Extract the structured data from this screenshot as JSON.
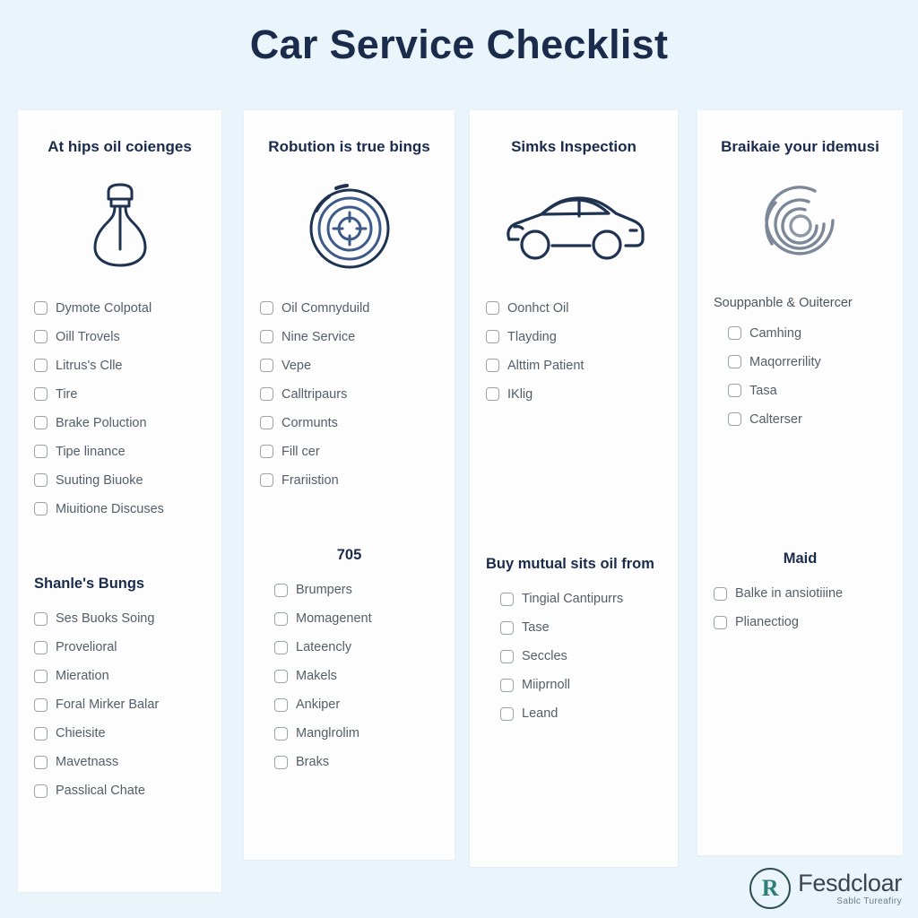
{
  "title": "Car Service Checklist",
  "colors": {
    "background": "#e9f5fb",
    "card": "#fdfdfd",
    "heading": "#1b2b4b",
    "label": "#545e69",
    "checkbox_border": "#9aa2ab",
    "logo_mark": "#2e7d78"
  },
  "columns": [
    {
      "header": "At hips oil coienges",
      "icon": "oil-bottle-icon",
      "sections": [
        {
          "heading": "",
          "items": [
            "Dymote Colpotal",
            "Oill Trovels",
            "Litrus's Clle",
            "Tire",
            "Brake Poluction",
            "Tipe linance",
            "Suuting Biuoke",
            "Miuitione Discuses"
          ]
        },
        {
          "heading": "Shanle's Bungs",
          "items": [
            "Ses Buoks Soing",
            "Provelioral",
            "Mieration",
            "Foral Mirker Balar",
            "Chieisite",
            "Mavetnass",
            "Passlical Chate"
          ]
        }
      ]
    },
    {
      "header": "Robution is true bings",
      "icon": "tire-wheel-icon",
      "sections": [
        {
          "heading": "",
          "items": [
            "Oil Comnyduild",
            "Nine Service",
            "Vepe",
            "Calltripaurs",
            "Cormunts",
            "Fill cer",
            "Frariistion"
          ]
        },
        {
          "heading": "705",
          "items": [
            "Brumpers",
            "Momagenent",
            "Lateencly",
            "Makels",
            "Ankiper",
            "Manglrolim",
            "Braks"
          ]
        }
      ]
    },
    {
      "header": "Simks Inspection",
      "icon": "car-side-icon",
      "sections": [
        {
          "heading": "",
          "items": [
            "Oonhct Oil",
            "Tlayding",
            "Alttim Patient",
            "IKlig"
          ]
        },
        {
          "heading": "Buy mutual sits oil from",
          "items": [
            "Tingial Cantipurrs",
            "Tase",
            "Seccles",
            "Miiprnoll",
            "Leand"
          ]
        }
      ]
    },
    {
      "header": "Braikaie your idemusi",
      "icon": "brake-disc-icon",
      "sections": [
        {
          "heading": "",
          "subheading": "Souppanble & Ouitercer",
          "items": [
            "Camhing",
            "Maqorrerility",
            "Tasa",
            "Calterser"
          ]
        },
        {
          "heading": "Maid",
          "items": [
            "Balke in ansiotiiine",
            "Plianectiog"
          ]
        }
      ]
    }
  ],
  "logo": {
    "mark": "R",
    "name": "Fesdcloar",
    "tagline": "Sablc Tureafiry"
  }
}
